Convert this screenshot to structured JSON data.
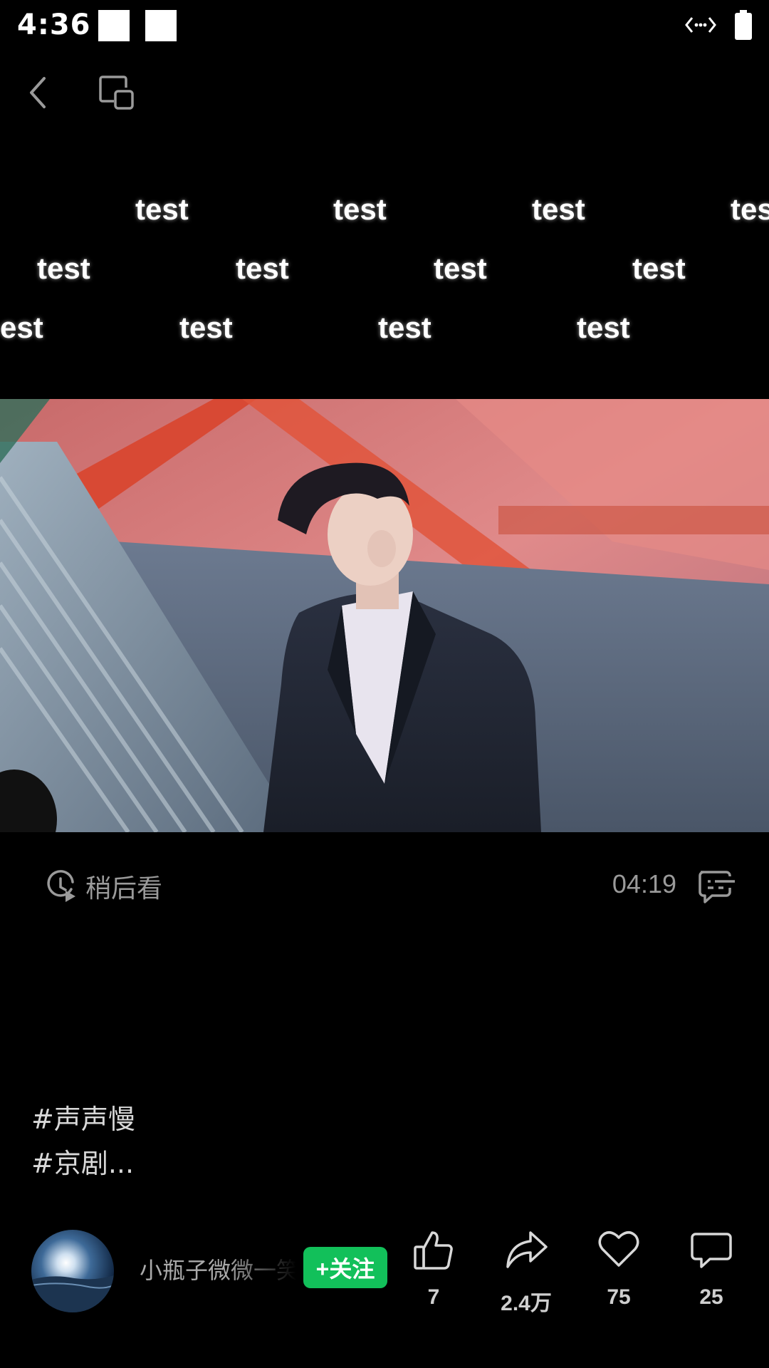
{
  "status_bar": {
    "time": "4:36",
    "icons": [
      "notification-square-icon",
      "notification-square-icon",
      "vpn-arrows-icon",
      "battery-icon"
    ]
  },
  "nav": {
    "back_icon": "chevron-left-icon",
    "pip_icon": "picture-in-picture-icon"
  },
  "watermark": {
    "text": "test",
    "rows": [
      [
        "test",
        "test",
        "test",
        "tes"
      ],
      [
        "test",
        "test",
        "test",
        "test"
      ],
      [
        "est",
        "test",
        "test",
        "test"
      ]
    ]
  },
  "video": {
    "scene": "man in dark suit, red temple roof background"
  },
  "video_meta": {
    "watch_later_label": "稍后看",
    "duration": "04:19",
    "danmaku_icon": "danmaku-icon"
  },
  "tags": [
    "#声声慢",
    "#京剧..."
  ],
  "author": {
    "name": "小瓶子微微一笑",
    "follow_label": "+关注"
  },
  "actions": {
    "like": {
      "icon": "thumbs-up-icon",
      "count": "7"
    },
    "share": {
      "icon": "share-arrow-icon",
      "count": "2.4万"
    },
    "favorite": {
      "icon": "heart-icon",
      "count": "75"
    },
    "comment": {
      "icon": "comment-bubble-icon",
      "count": "25"
    }
  },
  "colors": {
    "background": "#000000",
    "follow_button": "#12c05a",
    "secondary_text": "#9a9a9a"
  }
}
